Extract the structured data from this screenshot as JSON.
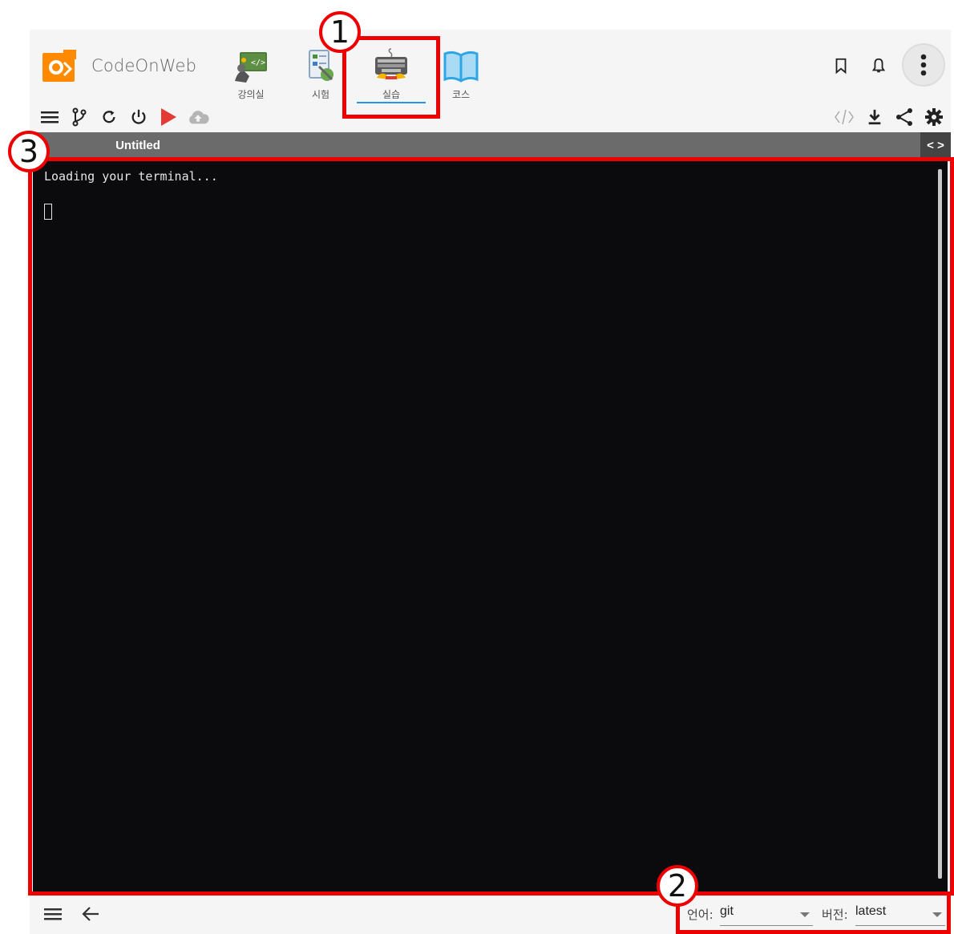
{
  "brand": {
    "name": "CodeOnWeb"
  },
  "nav": {
    "items": [
      {
        "label": "강의실",
        "icon": "classroom-icon"
      },
      {
        "label": "시험",
        "icon": "exam-icon"
      },
      {
        "label": "실습",
        "icon": "practice-keyboard-icon",
        "active": true
      },
      {
        "label": "코스",
        "icon": "book-icon"
      }
    ]
  },
  "header_icons": [
    "bookmark-icon",
    "bell-icon",
    "more-vert-icon"
  ],
  "toolbar": {
    "left": [
      "menu-icon",
      "branch-icon",
      "refresh-icon",
      "power-icon",
      "run-icon",
      "cloud-upload-icon"
    ],
    "right": [
      "code-icon",
      "download-icon",
      "share-icon",
      "gear-icon"
    ]
  },
  "editor": {
    "tab_title": "Untitled",
    "expand_symbol": "< >"
  },
  "terminal": {
    "loading_text": "Loading your terminal..."
  },
  "footer": {
    "language_label": "언어:",
    "language_value": "git",
    "version_label": "버전:",
    "version_value": "latest"
  },
  "annotations": {
    "one": "1",
    "two": "2",
    "three": "3"
  },
  "colors": {
    "accent": "#2196f3",
    "annotation": "#ee0000",
    "run": "#e53935",
    "terminal_bg": "#0b0b0d"
  }
}
